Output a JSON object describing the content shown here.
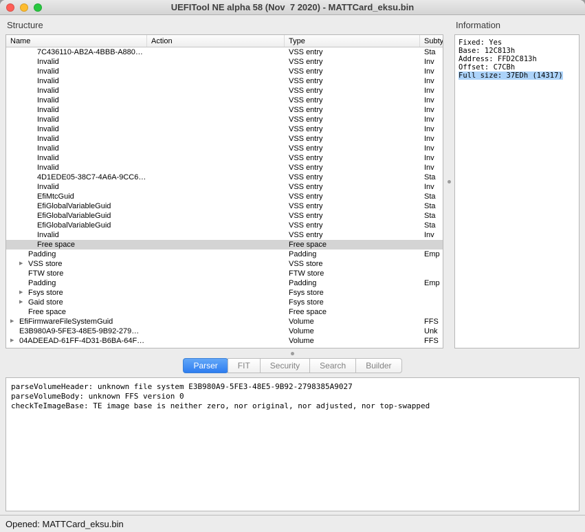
{
  "window": {
    "title": "UEFITool NE alpha 58 (Nov  7 2020) - MATTCard_eksu.bin"
  },
  "colors": {
    "tab_active_top": "#62a7f8",
    "tab_active_bottom": "#2e7df0",
    "info_highlight": "#acd3fa",
    "row_selected": "#d4d4d4",
    "traffic_red": "#ff5f57",
    "traffic_yellow": "#febc2e",
    "traffic_green": "#28c840"
  },
  "structure": {
    "label": "Structure",
    "columns": [
      "Name",
      "Action",
      "Type",
      "Subtype"
    ],
    "rows": [
      {
        "name": "7C436110-AB2A-4BBB-A880…",
        "type": "VSS entry",
        "subtype": "Sta",
        "level": 3
      },
      {
        "name": "Invalid",
        "type": "VSS entry",
        "subtype": "Inv",
        "level": 3
      },
      {
        "name": "Invalid",
        "type": "VSS entry",
        "subtype": "Inv",
        "level": 3
      },
      {
        "name": "Invalid",
        "type": "VSS entry",
        "subtype": "Inv",
        "level": 3
      },
      {
        "name": "Invalid",
        "type": "VSS entry",
        "subtype": "Inv",
        "level": 3
      },
      {
        "name": "Invalid",
        "type": "VSS entry",
        "subtype": "Inv",
        "level": 3
      },
      {
        "name": "Invalid",
        "type": "VSS entry",
        "subtype": "Inv",
        "level": 3
      },
      {
        "name": "Invalid",
        "type": "VSS entry",
        "subtype": "Inv",
        "level": 3
      },
      {
        "name": "Invalid",
        "type": "VSS entry",
        "subtype": "Inv",
        "level": 3
      },
      {
        "name": "Invalid",
        "type": "VSS entry",
        "subtype": "Inv",
        "level": 3
      },
      {
        "name": "Invalid",
        "type": "VSS entry",
        "subtype": "Inv",
        "level": 3
      },
      {
        "name": "Invalid",
        "type": "VSS entry",
        "subtype": "Inv",
        "level": 3
      },
      {
        "name": "Invalid",
        "type": "VSS entry",
        "subtype": "Inv",
        "level": 3
      },
      {
        "name": "4D1EDE05-38C7-4A6A-9CC6…",
        "type": "VSS entry",
        "subtype": "Sta",
        "level": 3
      },
      {
        "name": "Invalid",
        "type": "VSS entry",
        "subtype": "Inv",
        "level": 3
      },
      {
        "name": "EfiMtcGuid",
        "type": "VSS entry",
        "subtype": "Sta",
        "level": 3
      },
      {
        "name": "EfiGlobalVariableGuid",
        "type": "VSS entry",
        "subtype": "Sta",
        "level": 3
      },
      {
        "name": "EfiGlobalVariableGuid",
        "type": "VSS entry",
        "subtype": "Sta",
        "level": 3
      },
      {
        "name": "EfiGlobalVariableGuid",
        "type": "VSS entry",
        "subtype": "Sta",
        "level": 3
      },
      {
        "name": "Invalid",
        "type": "VSS entry",
        "subtype": "Inv",
        "level": 3
      },
      {
        "name": "Free space",
        "type": "Free space",
        "subtype": "",
        "level": 3,
        "selected": true
      },
      {
        "name": "Padding",
        "type": "Padding",
        "subtype": "Emp",
        "level": 2
      },
      {
        "name": "VSS store",
        "type": "VSS store",
        "subtype": "",
        "level": 2,
        "expandable": true
      },
      {
        "name": "FTW store",
        "type": "FTW store",
        "subtype": "",
        "level": 2
      },
      {
        "name": "Padding",
        "type": "Padding",
        "subtype": "Emp",
        "level": 2
      },
      {
        "name": "Fsys store",
        "type": "Fsys store",
        "subtype": "",
        "level": 2,
        "expandable": true
      },
      {
        "name": "Gaid store",
        "type": "Fsys store",
        "subtype": "",
        "level": 2,
        "expandable": true
      },
      {
        "name": "Free space",
        "type": "Free space",
        "subtype": "",
        "level": 2
      },
      {
        "name": "EfiFirmwareFileSystemGuid",
        "type": "Volume",
        "subtype": "FFS",
        "level": 1,
        "expandable": true
      },
      {
        "name": "E3B980A9-5FE3-48E5-9B92-279…",
        "type": "Volume",
        "subtype": "Unk",
        "level": 1
      },
      {
        "name": "04ADEEAD-61FF-4D31-B6BA-64F…",
        "type": "Volume",
        "subtype": "FFS",
        "level": 1,
        "expandable": true
      }
    ]
  },
  "information": {
    "label": "Information",
    "lines": [
      {
        "text": "Fixed: Yes",
        "highlight": false
      },
      {
        "text": "Base: 12C813h",
        "highlight": false
      },
      {
        "text": "Address: FFD2C813h",
        "highlight": false
      },
      {
        "text": "Offset: C7CBh",
        "highlight": false
      },
      {
        "text": "Full size: 37EDh (14317)",
        "highlight": true
      }
    ]
  },
  "tabs": [
    {
      "label": "Parser",
      "active": true
    },
    {
      "label": "FIT",
      "active": false
    },
    {
      "label": "Security",
      "active": false
    },
    {
      "label": "Search",
      "active": false
    },
    {
      "label": "Builder",
      "active": false
    }
  ],
  "messages": [
    "parseVolumeHeader: unknown file system E3B980A9-5FE3-48E5-9B92-2798385A9027",
    "parseVolumeBody: unknown FFS version 0",
    "checkTeImageBase: TE image base is neither zero, nor original, nor adjusted, nor top-swapped"
  ],
  "statusbar": {
    "text": "Opened: MATTCard_eksu.bin"
  }
}
